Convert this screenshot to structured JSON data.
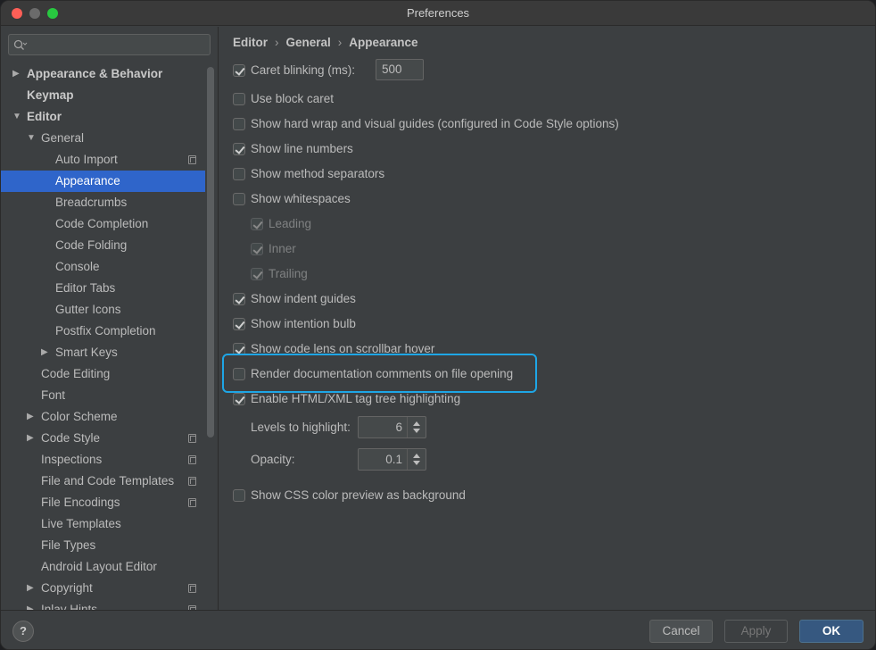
{
  "window": {
    "title": "Preferences"
  },
  "search": {
    "placeholder": ""
  },
  "tree": [
    {
      "label": "Appearance & Behavior",
      "arrow": "▶",
      "bold": true
    },
    {
      "label": "Keymap",
      "arrow": "",
      "bold": true
    },
    {
      "label": "Editor",
      "arrow": "▼",
      "bold": true
    },
    {
      "label": "General",
      "arrow": "▼"
    },
    {
      "label": "Auto Import",
      "arrow": "",
      "project_icon": true
    },
    {
      "label": "Appearance",
      "arrow": "",
      "selected": true
    },
    {
      "label": "Breadcrumbs",
      "arrow": ""
    },
    {
      "label": "Code Completion",
      "arrow": ""
    },
    {
      "label": "Code Folding",
      "arrow": ""
    },
    {
      "label": "Console",
      "arrow": ""
    },
    {
      "label": "Editor Tabs",
      "arrow": ""
    },
    {
      "label": "Gutter Icons",
      "arrow": ""
    },
    {
      "label": "Postfix Completion",
      "arrow": ""
    },
    {
      "label": "Smart Keys",
      "arrow": "▶"
    },
    {
      "label": "Code Editing",
      "arrow": ""
    },
    {
      "label": "Font",
      "arrow": ""
    },
    {
      "label": "Color Scheme",
      "arrow": "▶"
    },
    {
      "label": "Code Style",
      "arrow": "▶",
      "project_icon": true
    },
    {
      "label": "Inspections",
      "arrow": "",
      "project_icon": true
    },
    {
      "label": "File and Code Templates",
      "arrow": "",
      "project_icon": true
    },
    {
      "label": "File Encodings",
      "arrow": "",
      "project_icon": true
    },
    {
      "label": "Live Templates",
      "arrow": ""
    },
    {
      "label": "File Types",
      "arrow": ""
    },
    {
      "label": "Android Layout Editor",
      "arrow": ""
    },
    {
      "label": "Copyright",
      "arrow": "▶",
      "project_icon": true
    },
    {
      "label": "Inlay Hints",
      "arrow": "▶",
      "project_icon": true
    }
  ],
  "breadcrumb": {
    "part1": "Editor",
    "part2": "General",
    "part3": "Appearance",
    "sep": "›"
  },
  "options": {
    "caret_blinking": {
      "label": "Caret blinking (ms):",
      "checked": true,
      "value": "500"
    },
    "block_caret": {
      "label": "Use block caret",
      "checked": false
    },
    "hard_wrap": {
      "label": "Show hard wrap and visual guides (configured in Code Style options)",
      "checked": false
    },
    "line_numbers": {
      "label": "Show line numbers",
      "checked": true
    },
    "method_separators": {
      "label": "Show method separators",
      "checked": false
    },
    "whitespaces": {
      "label": "Show whitespaces",
      "checked": false
    },
    "leading": {
      "label": "Leading",
      "checked": true,
      "disabled": true
    },
    "inner": {
      "label": "Inner",
      "checked": true,
      "disabled": true
    },
    "trailing": {
      "label": "Trailing",
      "checked": true,
      "disabled": true
    },
    "indent_guides": {
      "label": "Show indent guides",
      "checked": true
    },
    "intention_bulb": {
      "label": "Show intention bulb",
      "checked": true
    },
    "code_lens": {
      "label": "Show code lens on scrollbar hover",
      "checked": true
    },
    "render_docs": {
      "label": "Render documentation comments on file opening",
      "checked": false
    },
    "tag_tree": {
      "label": "Enable HTML/XML tag tree highlighting",
      "checked": true
    },
    "levels": {
      "label": "Levels to highlight:",
      "value": "6"
    },
    "opacity": {
      "label": "Opacity:",
      "value": "0.1"
    },
    "css_preview": {
      "label": "Show CSS color preview as background",
      "checked": false
    }
  },
  "buttons": {
    "help": "?",
    "cancel": "Cancel",
    "apply": "Apply",
    "ok": "OK"
  },
  "colors": {
    "accent_highlight": "#1ea6e6",
    "selection": "#2f65ca",
    "ok_button": "#365880"
  }
}
